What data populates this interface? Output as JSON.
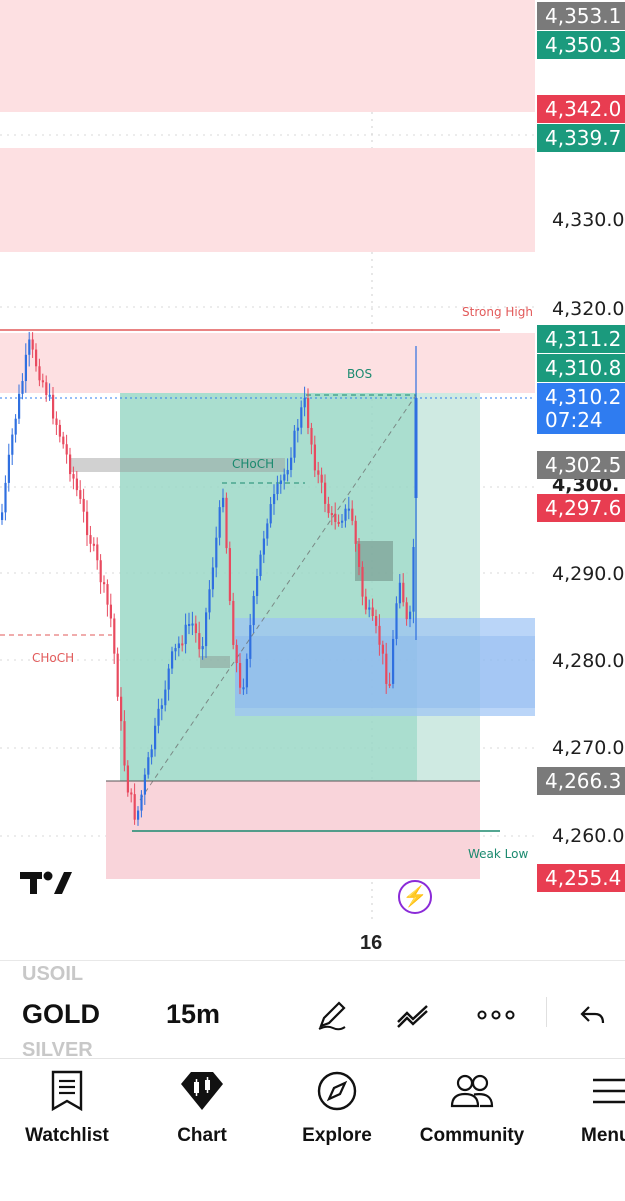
{
  "price_axis": {
    "tags": [
      {
        "label": "4,353.1",
        "color": "#7a7a7a"
      },
      {
        "label": "4,350.3",
        "color": "#1b9a7d"
      },
      {
        "label": "4,342.0",
        "color": "#e83d51"
      },
      {
        "label": "4,339.7",
        "color": "#1b9a7d"
      },
      {
        "label": "4,311.2",
        "color": "#1b9a7d"
      },
      {
        "label": "4,310.8",
        "color": "#1b9a7d"
      },
      {
        "label": "4,310.2",
        "color": "#2f7cf0"
      },
      {
        "label": "07:24",
        "color": "#2f7cf0"
      },
      {
        "label": "4,302.5",
        "color": "#7a7a7a"
      },
      {
        "label": "4,297.6",
        "color": "#e83d51"
      },
      {
        "label": "4,266.3",
        "color": "#7a7a7a"
      },
      {
        "label": "4,255.4",
        "color": "#e83d51"
      }
    ],
    "levels": [
      "4,330.0",
      "4,320.0",
      "4,300.",
      "4,290.0",
      "4,280.0",
      "4,270.0",
      "4,260.0"
    ]
  },
  "annotations": {
    "strong_high": "Strong High",
    "bos": "BOS",
    "choch_top": "CHoCH",
    "choch_left": "CHoCH",
    "weak_low": "Weak Low"
  },
  "time_axis": {
    "date": "16"
  },
  "symbol_bar": {
    "prev_symbol": "USOIL",
    "symbol": "GOLD",
    "next_symbol": "SILVER",
    "interval": "15m"
  },
  "icons": {
    "logo": "tradingview-logo",
    "flash": "lightning-icon",
    "draw": "pen-icon",
    "indicators": "indicators-icon",
    "more": "more-dots-icon",
    "undo": "undo-arrow-icon"
  },
  "nav": {
    "watchlist": "Watchlist",
    "chart": "Chart",
    "explore": "Explore",
    "community": "Community",
    "menu": "Menu"
  },
  "colors": {
    "bull": "#2f6fe0",
    "bear": "#e84a5f",
    "supply_zone": "#fde0e2",
    "position_profit": "#9bd8c7",
    "position_loss": "#f9d4da",
    "fvg_blue": "#9cc3f5",
    "accent": "#2f7cf0"
  }
}
